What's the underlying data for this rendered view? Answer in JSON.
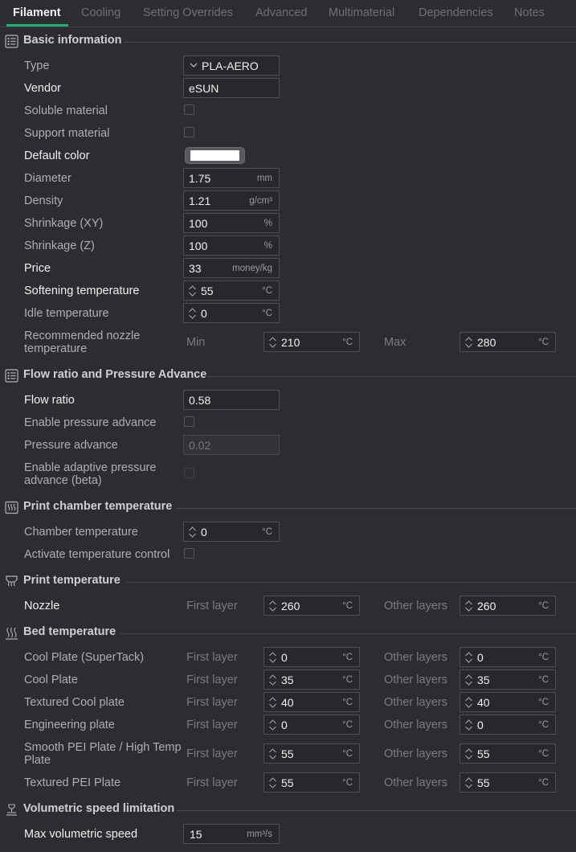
{
  "tabs": [
    "Filament",
    "Cooling",
    "Setting Overrides",
    "Advanced",
    "Multimaterial",
    "Dependencies",
    "Notes"
  ],
  "colors": {
    "accent": "#1bb27a",
    "background": "#2d2d31",
    "field_border": "#4e4e55",
    "default_color_swatch": "#ffffff"
  },
  "units": {
    "mm": "mm",
    "gcm3": "g/cm³",
    "pct": "%",
    "money": "money/kg",
    "temp": "°C",
    "vol": "mm³/s"
  },
  "basic": {
    "title": "Basic information",
    "type_label": "Type",
    "type_value": "PLA-AERO",
    "vendor_label": "Vendor",
    "vendor_value": "eSUN",
    "soluble_label": "Soluble material",
    "support_label": "Support material",
    "default_color_label": "Default color",
    "diameter_label": "Diameter",
    "diameter_value": "1.75",
    "density_label": "Density",
    "density_value": "1.21",
    "shrink_xy_label": "Shrinkage (XY)",
    "shrink_xy_value": "100",
    "shrink_z_label": "Shrinkage (Z)",
    "shrink_z_value": "100",
    "price_label": "Price",
    "price_value": "33",
    "softening_label": "Softening temperature",
    "softening_value": "55",
    "idle_label": "Idle temperature",
    "idle_value": "0",
    "rec_nozzle_label_1": "Recommended nozzle",
    "rec_nozzle_label_2": "temperature",
    "min_label": "Min",
    "min_value": "210",
    "max_label": "Max",
    "max_value": "280"
  },
  "flow": {
    "title": "Flow ratio and Pressure Advance",
    "ratio_label": "Flow ratio",
    "ratio_value": "0.58",
    "enable_pa_label": "Enable pressure advance",
    "pa_label": "Pressure advance",
    "pa_value": "0.02",
    "adaptive_label_1": "Enable adaptive pressure",
    "adaptive_label_2": "advance (beta)"
  },
  "chamber": {
    "title": "Print chamber temperature",
    "temp_label": "Chamber temperature",
    "temp_value": "0",
    "activate_label": "Activate temperature control"
  },
  "print_temp": {
    "title": "Print temperature",
    "nozzle_label": "Nozzle",
    "first_layer_label": "First layer",
    "first_value": "260",
    "other_layers_label": "Other layers",
    "other_value": "260"
  },
  "bed": {
    "title": "Bed temperature",
    "first_layer_label": "First layer",
    "other_layers_label": "Other layers",
    "plates": [
      {
        "name": "Cool Plate (SuperTack)",
        "first": "0",
        "other": "0"
      },
      {
        "name": "Cool Plate",
        "first": "35",
        "other": "35"
      },
      {
        "name": "Textured Cool plate",
        "first": "40",
        "other": "40"
      },
      {
        "name": "Engineering plate",
        "first": "0",
        "other": "0"
      },
      {
        "name_1": "Smooth PEI Plate / High Temp",
        "name_2": "Plate",
        "first": "55",
        "other": "55"
      },
      {
        "name": "Textured PEI Plate",
        "first": "55",
        "other": "55"
      }
    ]
  },
  "volumetric": {
    "title": "Volumetric speed limitation",
    "max_label": "Max volumetric speed",
    "max_value": "15"
  }
}
